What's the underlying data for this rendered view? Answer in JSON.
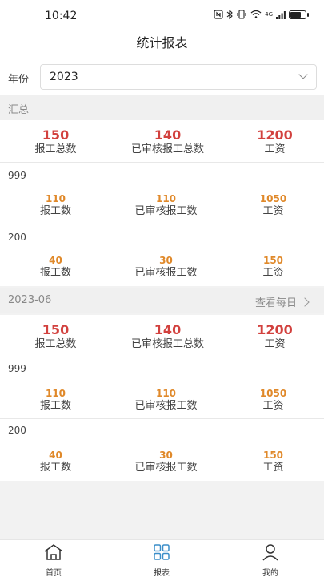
{
  "status": {
    "time": "10:42",
    "network": "4G"
  },
  "header": {
    "title": "统计报表"
  },
  "filter": {
    "year_label": "年份",
    "year_value": "2023"
  },
  "summary": {
    "title": "汇总",
    "totals": [
      {
        "value": "150",
        "label": "报工总数"
      },
      {
        "value": "140",
        "label": "已审核报工总数"
      },
      {
        "value": "1200",
        "label": "工资"
      }
    ],
    "groups": [
      {
        "name": "999",
        "metrics": [
          {
            "value": "110",
            "label": "报工数"
          },
          {
            "value": "110",
            "label": "已审核报工数"
          },
          {
            "value": "1050",
            "label": "工资"
          }
        ]
      },
      {
        "name": "200",
        "metrics": [
          {
            "value": "40",
            "label": "报工数"
          },
          {
            "value": "30",
            "label": "已审核报工数"
          },
          {
            "value": "150",
            "label": "工资"
          }
        ]
      }
    ]
  },
  "month": {
    "title": "2023-06",
    "link": "查看每日",
    "totals": [
      {
        "value": "150",
        "label": "报工总数"
      },
      {
        "value": "140",
        "label": "已审核报工总数"
      },
      {
        "value": "1200",
        "label": "工资"
      }
    ],
    "groups": [
      {
        "name": "999",
        "metrics": [
          {
            "value": "110",
            "label": "报工数"
          },
          {
            "value": "110",
            "label": "已审核报工数"
          },
          {
            "value": "1050",
            "label": "工资"
          }
        ]
      },
      {
        "name": "200",
        "metrics": [
          {
            "value": "40",
            "label": "报工数"
          },
          {
            "value": "30",
            "label": "已审核报工数"
          },
          {
            "value": "150",
            "label": "工资"
          }
        ]
      }
    ]
  },
  "tabs": [
    {
      "label": "首页",
      "icon": "home-icon"
    },
    {
      "label": "报表",
      "icon": "grid-icon"
    },
    {
      "label": "我的",
      "icon": "user-icon"
    }
  ],
  "colors": {
    "primary_value": "#d2413e",
    "secondary_value": "#e0892a",
    "tab_accent": "#3a8ec9"
  }
}
